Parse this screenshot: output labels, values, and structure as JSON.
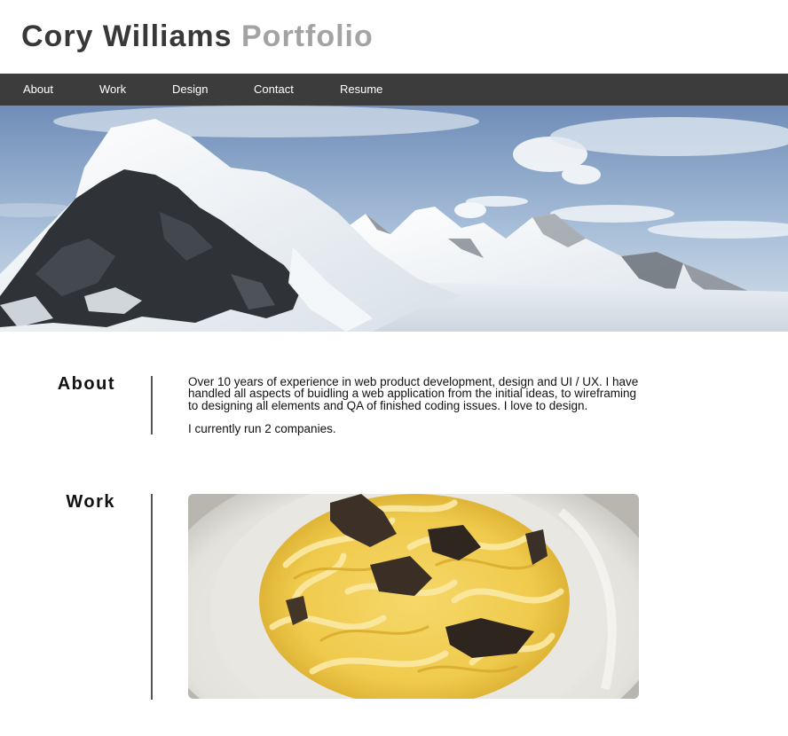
{
  "header": {
    "name": "Cory Williams",
    "subtitle": "Portfolio"
  },
  "nav": {
    "items": [
      {
        "label": "About"
      },
      {
        "label": "Work"
      },
      {
        "label": "Design"
      },
      {
        "label": "Contact"
      },
      {
        "label": "Resume"
      }
    ]
  },
  "hero": {
    "image": "mountain-landscape"
  },
  "about": {
    "heading": "About",
    "paragraphs": [
      "Over 10 years of experience in web product development, design and UI / UX. I have handled all aspects of buidling a web application from the initial ideas, to wireframing to designing all elements and QA of finished coding issues. I love to design.",
      "I currently run 2 companies."
    ]
  },
  "work": {
    "heading": "Work",
    "image": "pasta-dish"
  },
  "colors": {
    "title": "#383838",
    "subtitle": "#a3a3a3",
    "navbar": "#3c3c3c",
    "divider": "#555555"
  }
}
